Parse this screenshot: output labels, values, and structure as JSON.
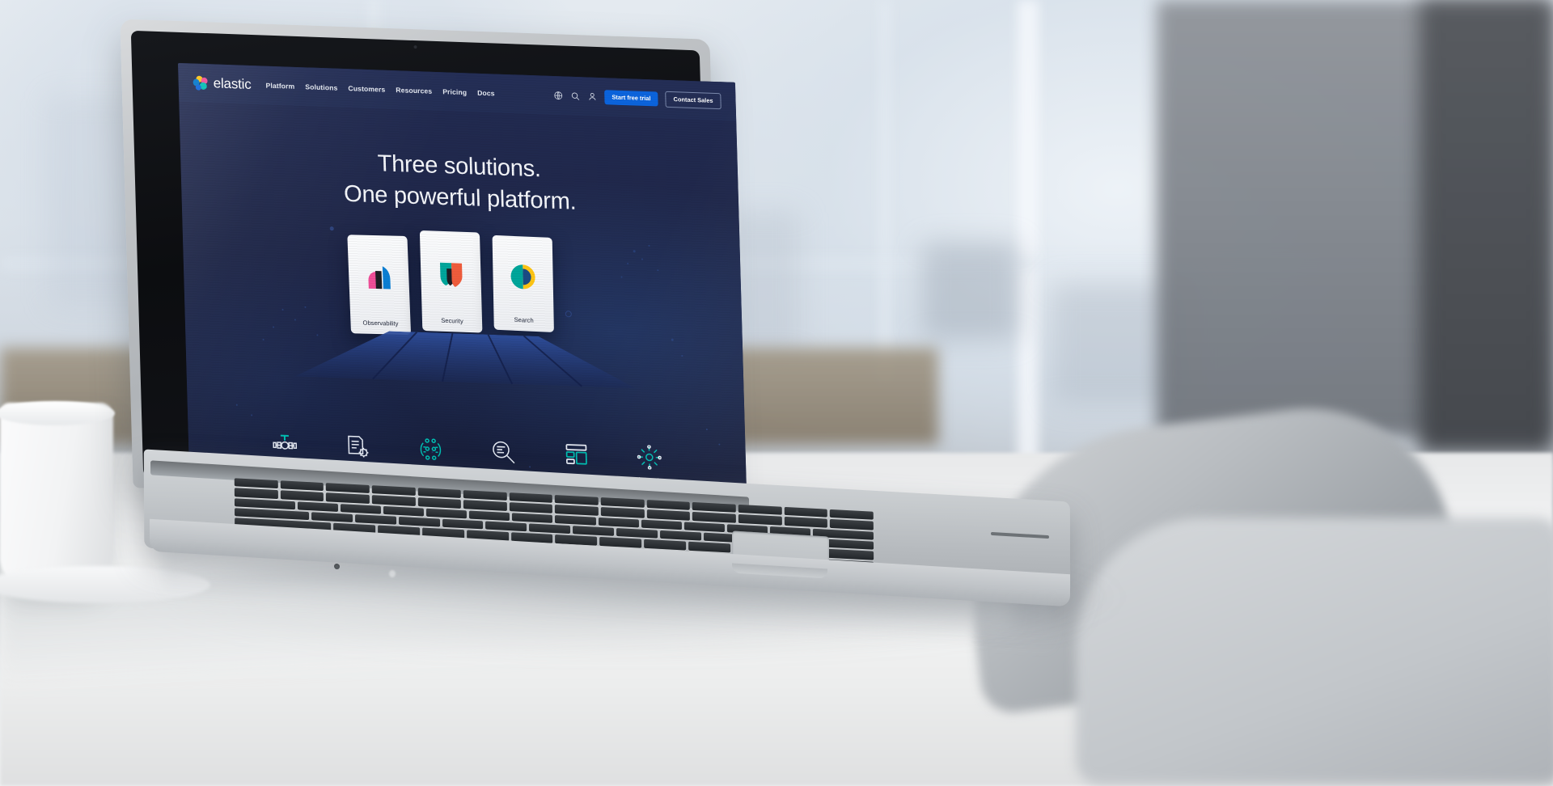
{
  "site": {
    "brand": {
      "name": "elastic",
      "logo_icon": "elastic-logo-icon"
    },
    "nav_links": [
      "Platform",
      "Solutions",
      "Customers",
      "Resources",
      "Pricing",
      "Docs"
    ],
    "nav_icons": [
      {
        "name": "globe-icon",
        "label": "Language"
      },
      {
        "name": "search-icon",
        "label": "Search"
      },
      {
        "name": "user-icon",
        "label": "Account"
      }
    ],
    "cta": {
      "primary_label": "Start free trial",
      "secondary_label": "Contact Sales",
      "primary_color": "#0b64dd"
    }
  },
  "hero": {
    "headline_line1": "Three solutions.",
    "headline_line2": "One powerful platform."
  },
  "solution_cards": [
    {
      "label": "Observability",
      "icon": "observability-bars-icon",
      "colors": [
        "#f04e98",
        "#1d1e24",
        "#0b7fd4"
      ]
    },
    {
      "label": "Security",
      "icon": "security-shield-icon",
      "colors": [
        "#00a69b",
        "#1d1e24",
        "#f05c3c"
      ]
    },
    {
      "label": "Search",
      "icon": "search-circle-icon",
      "colors": [
        "#00a69b",
        "#fec514"
      ]
    }
  ],
  "capabilities": [
    {
      "label": "Ingest",
      "icon": "pipeline-valve-icon",
      "accent": "#00bfb3"
    },
    {
      "label": "Store",
      "icon": "document-gear-icon",
      "accent": "#ffffff"
    },
    {
      "label": "Leverage AI",
      "icon": "ai-nodes-icon",
      "accent": "#00bfb3"
    },
    {
      "label": "Search",
      "icon": "magnifier-lines-icon",
      "accent": "#ffffff"
    },
    {
      "label": "Visualize",
      "icon": "dashboard-layout-icon",
      "accent": "#00bfb3"
    },
    {
      "label": "Automate",
      "icon": "automation-gear-network-icon",
      "accent": "#00bfb3"
    }
  ],
  "theme": {
    "screen_bg": "#1f2749",
    "text_primary": "#f4f6fa",
    "accent_teal": "#00bfb3",
    "accent_blue": "#0b64dd"
  },
  "device": {
    "brand_text": ""
  }
}
